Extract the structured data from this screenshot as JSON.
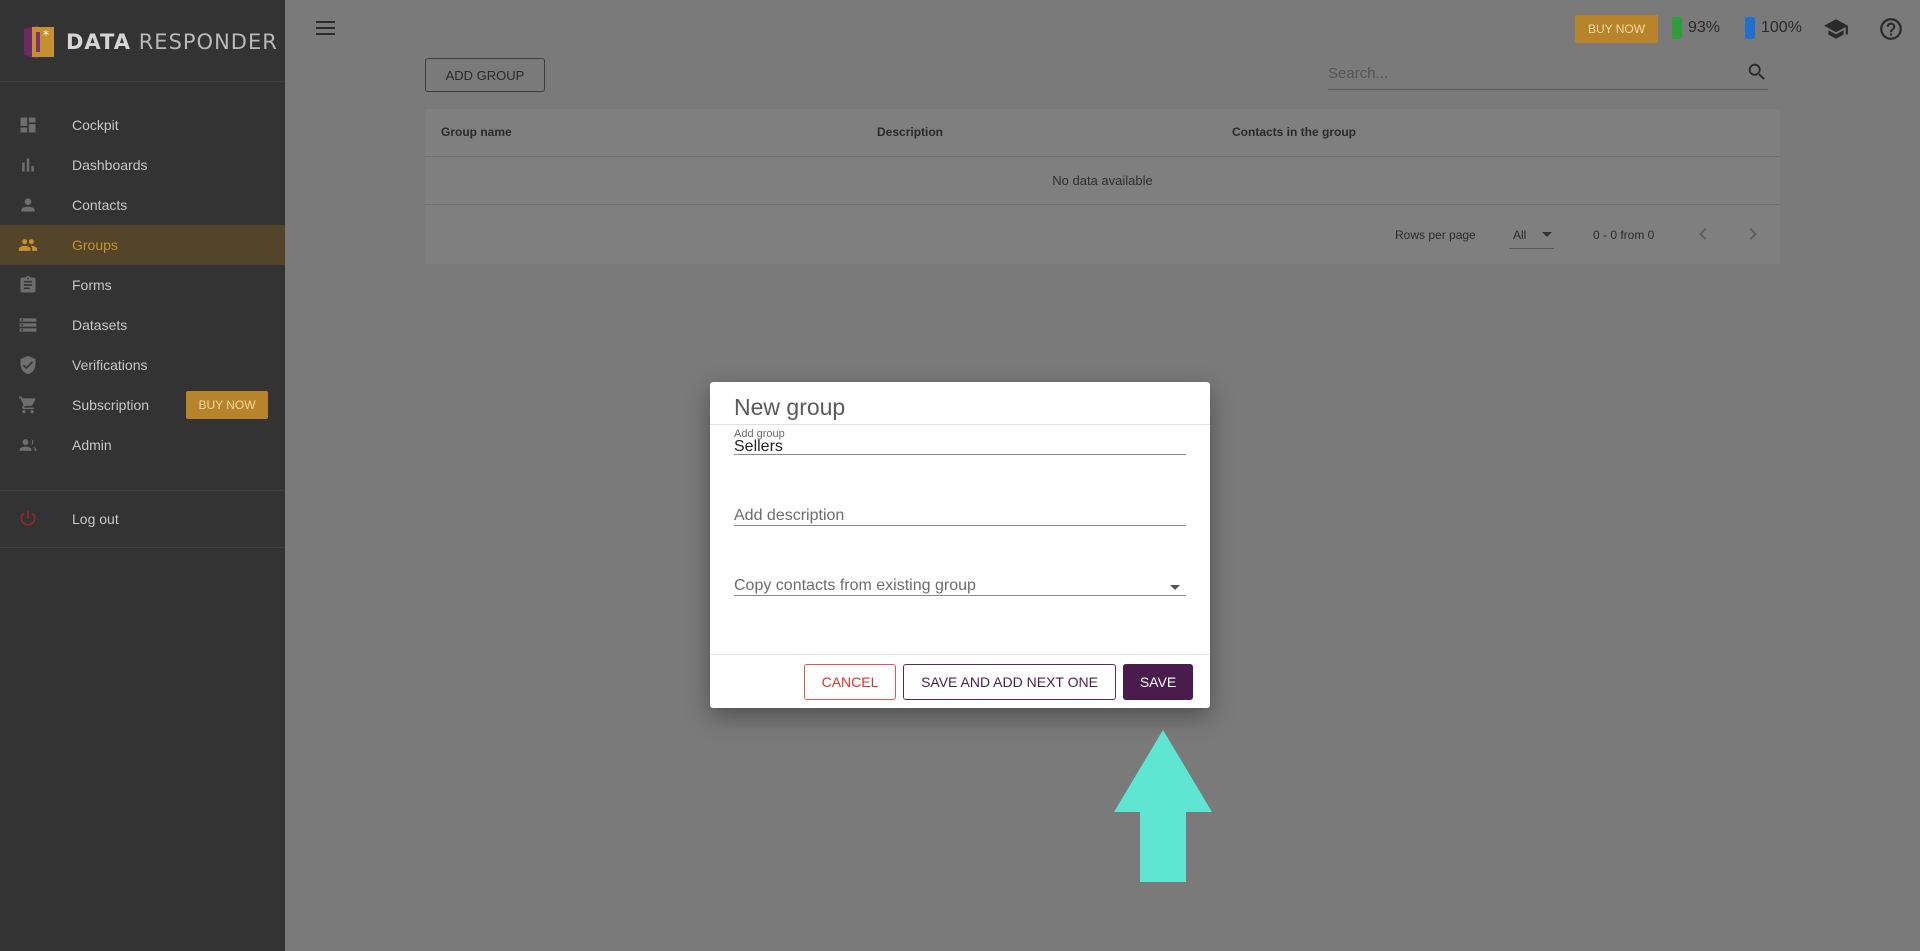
{
  "brand": {
    "name_bold": "DATA",
    "name_rest": "RESPONDER"
  },
  "sidebar": {
    "items": [
      {
        "label": "Cockpit",
        "icon": "dashboard-icon"
      },
      {
        "label": "Dashboards",
        "icon": "bar-chart-icon"
      },
      {
        "label": "Contacts",
        "icon": "person-icon"
      },
      {
        "label": "Groups",
        "icon": "people-icon",
        "active": true
      },
      {
        "label": "Forms",
        "icon": "clipboard-icon"
      },
      {
        "label": "Datasets",
        "icon": "list-icon"
      },
      {
        "label": "Verifications",
        "icon": "shield-check-icon"
      },
      {
        "label": "Subscription",
        "icon": "cart-icon",
        "badge": "BUY NOW"
      },
      {
        "label": "Admin",
        "icon": "admin-people-icon"
      }
    ],
    "logout_label": "Log out"
  },
  "topbar": {
    "buy_now": "BUY NOW",
    "battery_green": "93%",
    "battery_blue": "100%",
    "colors": {
      "green": "#2e9e3a",
      "blue": "#1e6fd1"
    }
  },
  "content": {
    "add_group": "ADD GROUP",
    "search_placeholder": "Search...",
    "table": {
      "columns": [
        "Group name",
        "Description",
        "Contacts in the group"
      ],
      "empty_text": "No data available",
      "rows_per_page_label": "Rows per page",
      "rows_per_page_value": "All",
      "range_text": "0 - 0 from 0"
    }
  },
  "dialog": {
    "title": "New group",
    "group_field_label": "Add group",
    "group_field_value": "Sellers",
    "description_placeholder": "Add description",
    "copy_placeholder": "Copy contacts from existing group",
    "cancel": "CANCEL",
    "save_next": "SAVE AND ADD NEXT ONE",
    "save": "SAVE"
  },
  "colors": {
    "accent": "#c4912e",
    "dialog_primary": "#4a1c4d",
    "cancel_red": "#d9342f",
    "arrow": "#5ee6d2"
  }
}
